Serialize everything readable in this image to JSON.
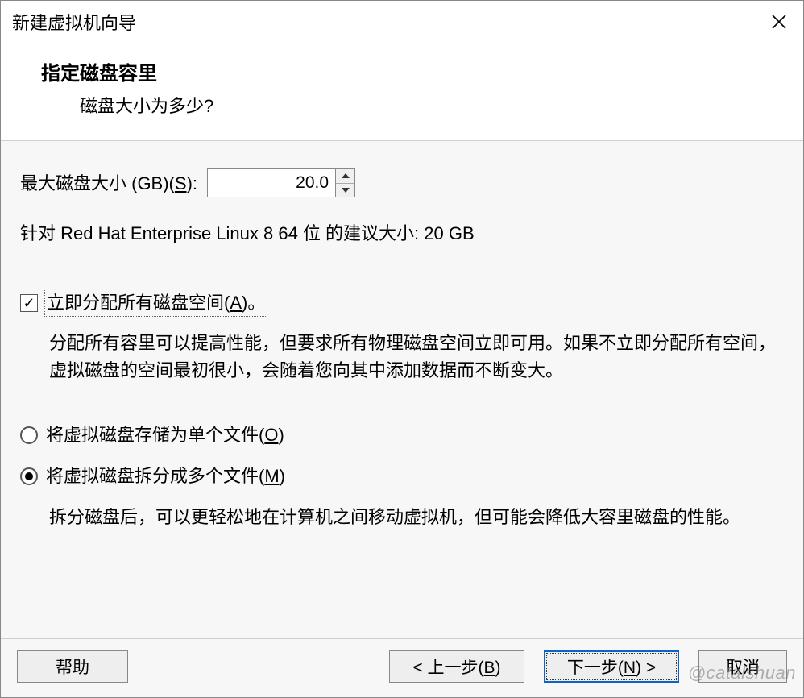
{
  "titlebar": {
    "title": "新建虚拟机向导"
  },
  "header": {
    "title": "指定磁盘容里",
    "subtitle": "磁盘大小为多少?"
  },
  "disk_size": {
    "label_prefix": "最大磁盘大小 (GB)(",
    "label_hotkey": "S",
    "label_suffix": "):",
    "value": "20.0"
  },
  "recommend": "针对 Red Hat Enterprise Linux 8 64 位 的建议大小: 20 GB",
  "allocate_now": {
    "checked": true,
    "label_prefix": "立即分配所有磁盘空间(",
    "label_hotkey": "A",
    "label_suffix": ")。",
    "description": "分配所有容里可以提高性能，但要求所有物理磁盘空间立即可用。如果不立即分配所有空间，虚拟磁盘的空间最初很小，会随着您向其中添加数据而不断变大。"
  },
  "store_single": {
    "checked": false,
    "label_prefix": "将虚拟磁盘存储为单个文件(",
    "label_hotkey": "O",
    "label_suffix": ")"
  },
  "store_split": {
    "checked": true,
    "label_prefix": "将虚拟磁盘拆分成多个文件(",
    "label_hotkey": "M",
    "label_suffix": ")",
    "description": "拆分磁盘后，可以更轻松地在计算机之间移动虚拟机，但可能会降低大容里磁盘的性能。"
  },
  "footer": {
    "help": "帮助",
    "back_prefix": "< 上一步(",
    "back_hotkey": "B",
    "back_suffix": ")",
    "next_prefix": "下一步(",
    "next_hotkey": "N",
    "next_suffix": ") >",
    "cancel": "取消"
  },
  "watermark": "@catalshuan"
}
